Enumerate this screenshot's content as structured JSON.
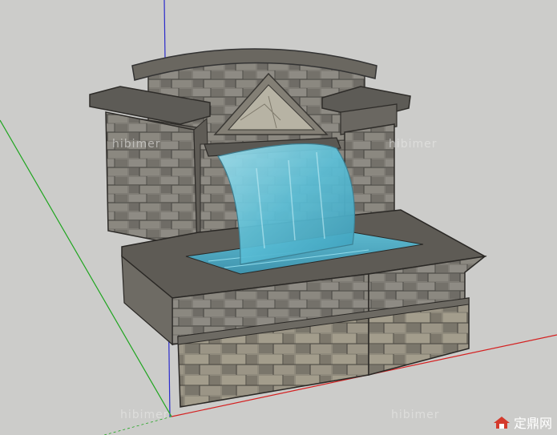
{
  "watermarks": [
    "hibimer",
    "hibimer",
    "hibimer",
    "hibimer"
  ],
  "brand": {
    "text": "定鼎网"
  },
  "colors": {
    "background": "#ccccca",
    "axis_red": "#d42020",
    "axis_green": "#1fa51f",
    "axis_blue": "#2a2acc",
    "stone_dark": "#5c5a55",
    "stone_mid": "#8a8780",
    "stone_light": "#a7a49b",
    "water": "#4fb6cf",
    "brand_red": "#d43a2c"
  }
}
